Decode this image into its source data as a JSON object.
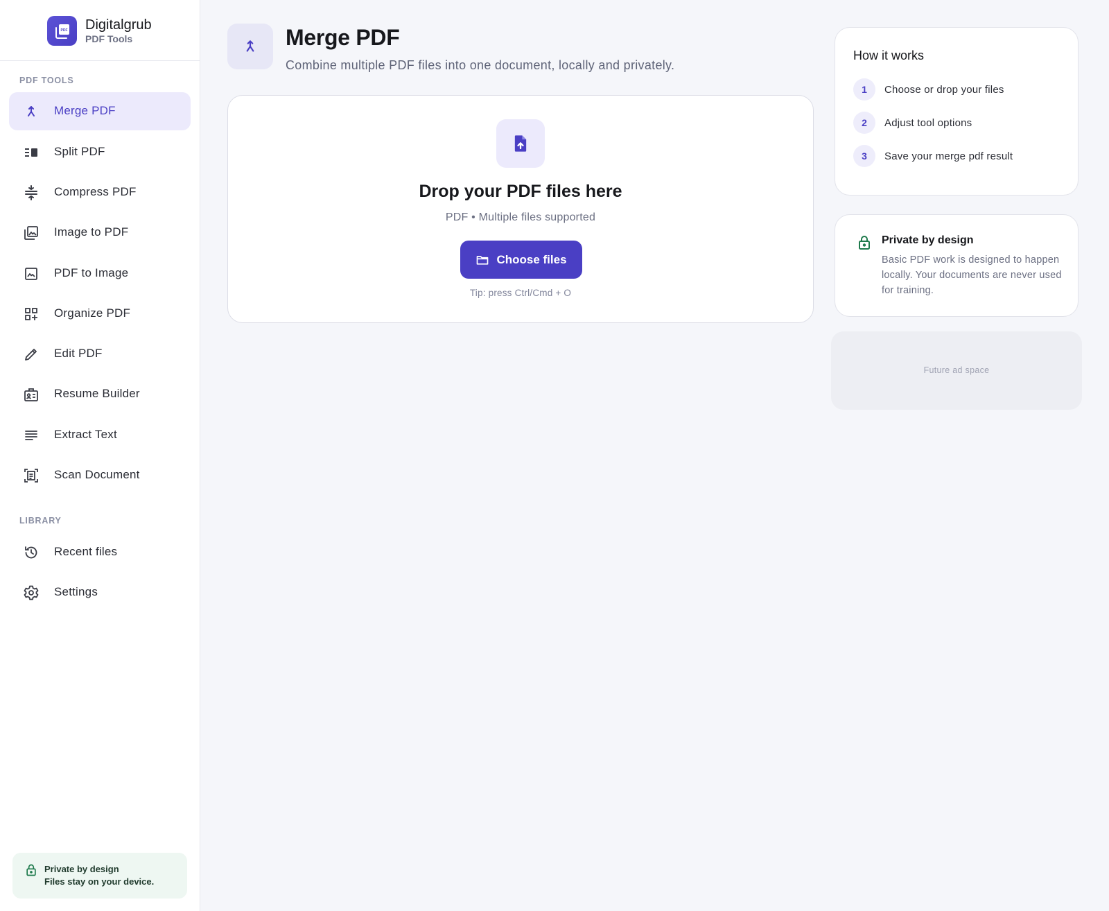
{
  "brand": {
    "name": "Digitalgrub",
    "subtitle": "PDF Tools",
    "logo_icon": "pdf-stack-icon",
    "logo_text": "PDF"
  },
  "sidebar": {
    "sections": [
      {
        "label": "PDF TOOLS",
        "items": [
          {
            "label": "Merge PDF",
            "icon": "merge-icon",
            "active": true
          },
          {
            "label": "Split PDF",
            "icon": "split-icon"
          },
          {
            "label": "Compress PDF",
            "icon": "compress-icon"
          },
          {
            "label": "Image to PDF",
            "icon": "image-stack-icon"
          },
          {
            "label": "PDF to Image",
            "icon": "image-icon"
          },
          {
            "label": "Organize PDF",
            "icon": "grid-add-icon"
          },
          {
            "label": "Edit PDF",
            "icon": "pencil-icon"
          },
          {
            "label": "Resume Builder",
            "icon": "id-badge-icon"
          },
          {
            "label": "Extract Text",
            "icon": "text-lines-icon"
          },
          {
            "label": "Scan Document",
            "icon": "scan-icon"
          }
        ]
      },
      {
        "label": "LIBRARY",
        "items": [
          {
            "label": "Recent files",
            "icon": "history-icon"
          },
          {
            "label": "Settings",
            "icon": "gear-icon"
          }
        ]
      }
    ],
    "footer": {
      "line1": "Private by design",
      "line2": "Files stay on your device.",
      "icon": "lock-icon"
    }
  },
  "header": {
    "title": "Merge PDF",
    "subtitle": "Combine multiple PDF files into one document, locally and privately.",
    "icon": "merge-icon"
  },
  "dropzone": {
    "icon": "file-upload-icon",
    "title": "Drop your PDF files here",
    "subtitle": "PDF • Multiple files supported",
    "button_label": "Choose files",
    "button_icon": "folder-icon",
    "tip": "Tip: press Ctrl/Cmd + O"
  },
  "how_it_works": {
    "title": "How it works",
    "steps": [
      {
        "num": "1",
        "text": "Choose or drop your files"
      },
      {
        "num": "2",
        "text": "Adjust tool options"
      },
      {
        "num": "3",
        "text": "Save your merge pdf result"
      }
    ]
  },
  "privacy_card": {
    "title": "Private by design",
    "body": "Basic PDF work is designed to happen locally. Your documents are never used for training.",
    "icon": "lock-icon"
  },
  "ad": {
    "label": "Future ad space"
  },
  "colors": {
    "accent": "#4a3fc4",
    "accent_soft": "#eceafc",
    "privacy_green": "#1e7a4c",
    "background": "#f5f6fa"
  }
}
